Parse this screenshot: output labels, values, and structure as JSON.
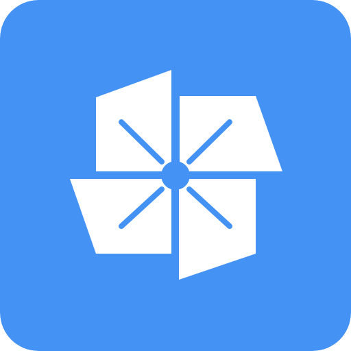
{
  "icon": {
    "name": "pinwheel-app-icon",
    "depicts": "pinwheel",
    "colors": {
      "background": "#4492F3",
      "foreground": "#FFFFFF"
    }
  }
}
